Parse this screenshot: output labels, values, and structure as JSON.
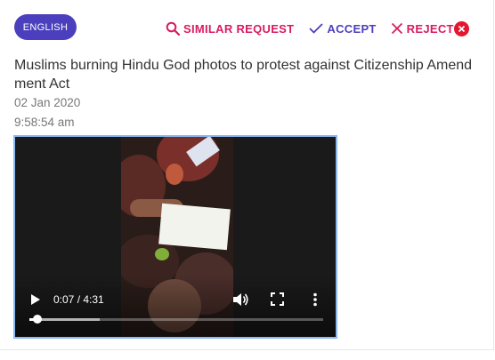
{
  "badge": {
    "label": "ENGLISH"
  },
  "actions": {
    "similar_label": "SIMILAR REQUEST",
    "accept_label": "ACCEPT",
    "reject_label": "REJECT"
  },
  "post": {
    "title": "Muslims burning Hindu God photos to protest against Citizenship Amendment Act",
    "date": "02 Jan 2020",
    "time": "9:58:54 am"
  },
  "video": {
    "time_display": "0:07 / 4:31",
    "played_fraction": 0.026,
    "buffered_fraction": 0.24
  },
  "colors": {
    "accent_purple": "#4b3fbd",
    "accent_pink": "#d81b60",
    "close_red": "#e3172e",
    "video_border": "#8ab8f0"
  },
  "icons": [
    "search-icon",
    "checkmark-icon",
    "x-icon",
    "close-circle-icon",
    "play-icon",
    "volume-icon",
    "fullscreen-icon",
    "more-vert-icon"
  ]
}
